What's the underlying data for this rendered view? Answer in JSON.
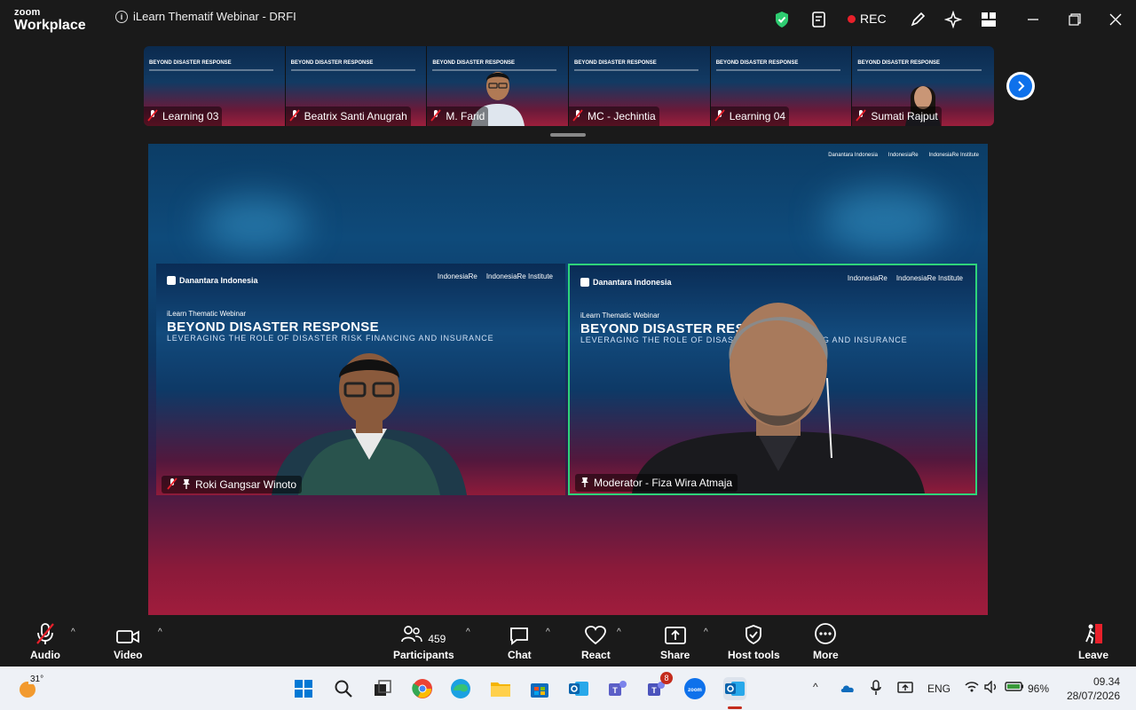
{
  "app": {
    "brand_top": "zoom",
    "brand_bottom": "Workplace",
    "meeting_title": "iLearn Thematif Webinar - DRFI",
    "rec_label": "REC"
  },
  "thumbnails": [
    {
      "name": "Learning 03"
    },
    {
      "name": "Beatrix Santi Anugrah"
    },
    {
      "name": "M. Farid"
    },
    {
      "name": "MC - Jechintia"
    },
    {
      "name": "Learning 04"
    },
    {
      "name": "Sumati Rajput"
    }
  ],
  "slide": {
    "brand": "Danantara Indonesia",
    "partner1": "IndonesiaRe",
    "partner2": "IndonesiaRe Institute",
    "kicker": "iLearn Thematic Webinar",
    "headline": "BEYOND DISASTER RESPONSE",
    "subline": "LEVERAGING THE ROLE OF DISASTER RISK FINANCING AND INSURANCE"
  },
  "speakers": [
    {
      "name": "Roki Gangsar Winoto",
      "active": false
    },
    {
      "name": "Moderator - Fiza Wira Atmaja",
      "active": true
    }
  ],
  "controls": {
    "audio": "Audio",
    "video": "Video",
    "participants": "Participants",
    "participants_count": "459",
    "chat": "Chat",
    "react": "React",
    "share": "Share",
    "host_tools": "Host tools",
    "more": "More",
    "leave": "Leave"
  },
  "taskbar": {
    "temperature": "31°",
    "teams_badge": "8",
    "language": "ENG",
    "battery": "96%",
    "time": "09.34",
    "date": "28/07/2026"
  },
  "colors": {
    "active_speaker_border": "#2ed47a",
    "rec_dot": "#e8202a",
    "zoom_blue": "#0e71eb"
  }
}
